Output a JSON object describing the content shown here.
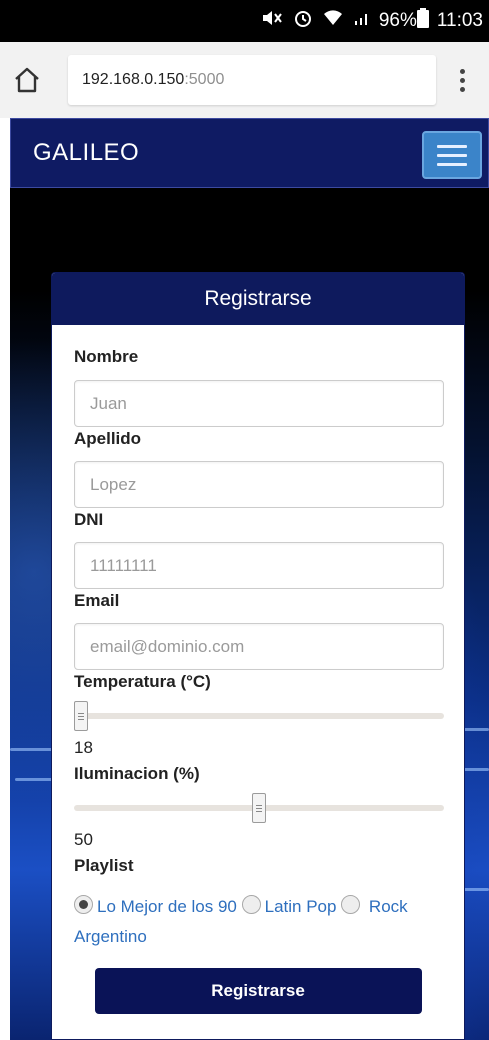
{
  "status_bar": {
    "battery": "96%",
    "time": "11:03"
  },
  "browser": {
    "url_host": "192.168.0.150",
    "url_port": ":5000"
  },
  "navbar": {
    "brand": "GALILEO"
  },
  "form": {
    "title": "Registrarse",
    "nombre": {
      "label": "Nombre",
      "placeholder": "Juan"
    },
    "apellido": {
      "label": "Apellido",
      "placeholder": "Lopez"
    },
    "dni": {
      "label": "DNI",
      "placeholder": "11111111"
    },
    "email": {
      "label": "Email",
      "placeholder": "email@dominio.com"
    },
    "temperatura": {
      "label": "Temperatura (°C)",
      "value": "18",
      "fraction": 0.0
    },
    "iluminacion": {
      "label": "Iluminacion (%)",
      "value": "50",
      "fraction": 0.5
    },
    "playlist": {
      "label": "Playlist",
      "options": [
        "Lo Mejor de los 90",
        "Latin Pop",
        "Rock Argentino"
      ],
      "selected": "Lo Mejor de los 90"
    },
    "submit_label": "Registrarse"
  }
}
